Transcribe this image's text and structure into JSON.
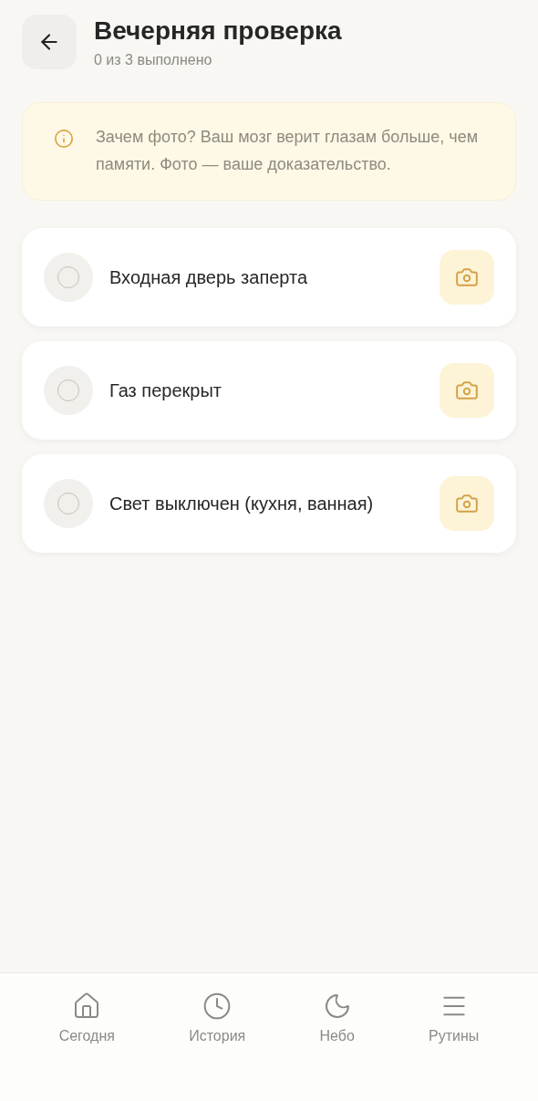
{
  "header": {
    "title": "Вечерняя проверка",
    "subtitle": "0 из 3 выполнено"
  },
  "notice": {
    "text": "Зачем фото? Ваш мозг верит глазам больше, чем памяти. Фото — ваше доказательство."
  },
  "tasks": [
    {
      "label": "Входная дверь заперта",
      "checked": false
    },
    {
      "label": "Газ перекрыт",
      "checked": false
    },
    {
      "label": "Свет выключен (кухня, ванная)",
      "checked": false
    }
  ],
  "nav": [
    {
      "label": "Сегодня",
      "selected": false
    },
    {
      "label": "История",
      "selected": false
    },
    {
      "label": "Небо",
      "selected": false
    },
    {
      "label": "Рутины",
      "selected": false
    }
  ]
}
